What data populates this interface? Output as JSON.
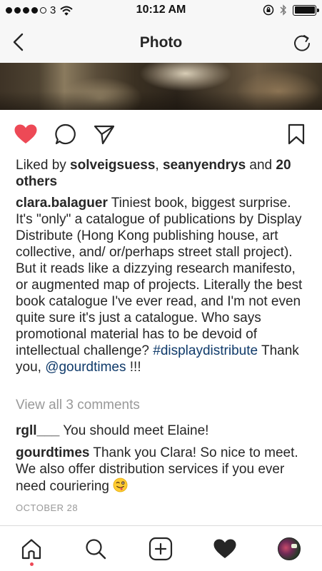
{
  "status_bar": {
    "carrier": "3",
    "time": "10:12 AM"
  },
  "nav": {
    "title": "Photo"
  },
  "likes": {
    "prefix": "Liked by ",
    "user1": "solveigsuess",
    "sep": ", ",
    "user2": "seanyendrys",
    "and": " and ",
    "others": "20 others"
  },
  "caption": {
    "username": "clara.balaguer",
    "text": " Tiniest book, biggest surprise. It's \"only\" a catalogue of publications by Display Distribute (Hong Kong publishing house, art collective, and/ or/perhaps street stall project). But it reads like a dizzying research manifesto, or augmented map of projects. Literally the best book catalogue I've ever read, and I'm not even quite sure it's just a catalogue. Who says promotional material has to be devoid of intellectual challenge? ",
    "hashtag": "#displaydistribute",
    "thanks": " Thank you, ",
    "mention": "@gourdtimes",
    "suffix": " !!!"
  },
  "view_all_comments": "View all 3 comments",
  "comments": [
    {
      "username": "rgll___",
      "text": " You should meet Elaine!"
    },
    {
      "username": "gourdtimes",
      "text": " Thank you Clara! So nice to meet. We also offer distribution services if you ever need couriering "
    }
  ],
  "date": "OCTOBER 28",
  "colors": {
    "like_red": "#ed4956",
    "link_blue": "#0f3a6a",
    "muted_gray": "#999999",
    "text": "#262626"
  },
  "icons": {
    "back": "chevron-left-icon",
    "refresh": "refresh-icon",
    "like": "heart-filled-icon",
    "comment": "comment-bubble-icon",
    "share": "paper-plane-icon",
    "save": "bookmark-icon",
    "home": "home-icon",
    "search": "search-icon",
    "add": "add-post-icon",
    "activity": "heart-icon",
    "profile": "avatar",
    "emoji": "winking-tongue-emoji"
  }
}
